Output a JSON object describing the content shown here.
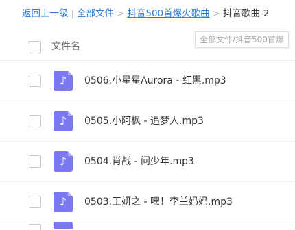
{
  "breadcrumb": {
    "back": "返回上一级",
    "sep1": "|",
    "all_files": "全部文件",
    "sep2": ">",
    "folder": "抖音500首爆火歌曲",
    "sep3": ">",
    "current": "抖音歌曲-2"
  },
  "tooltip": "全部文件/抖音500首爆",
  "list_header": {
    "label": "文件名"
  },
  "files": [
    {
      "name": "0506.小星星Aurora - 红黑.mp3",
      "icon": "music-note-icon"
    },
    {
      "name": "0505.小阿枫 - 追梦人.mp3",
      "icon": "music-note-icon"
    },
    {
      "name": "0504.肖战 - 问少年.mp3",
      "icon": "music-note-icon"
    },
    {
      "name": "0503.王妍之 - 嘿！李兰妈妈.mp3",
      "icon": "music-note-icon"
    }
  ],
  "colors": {
    "link": "#2b7ad8",
    "file_icon": "#7b78f0"
  }
}
